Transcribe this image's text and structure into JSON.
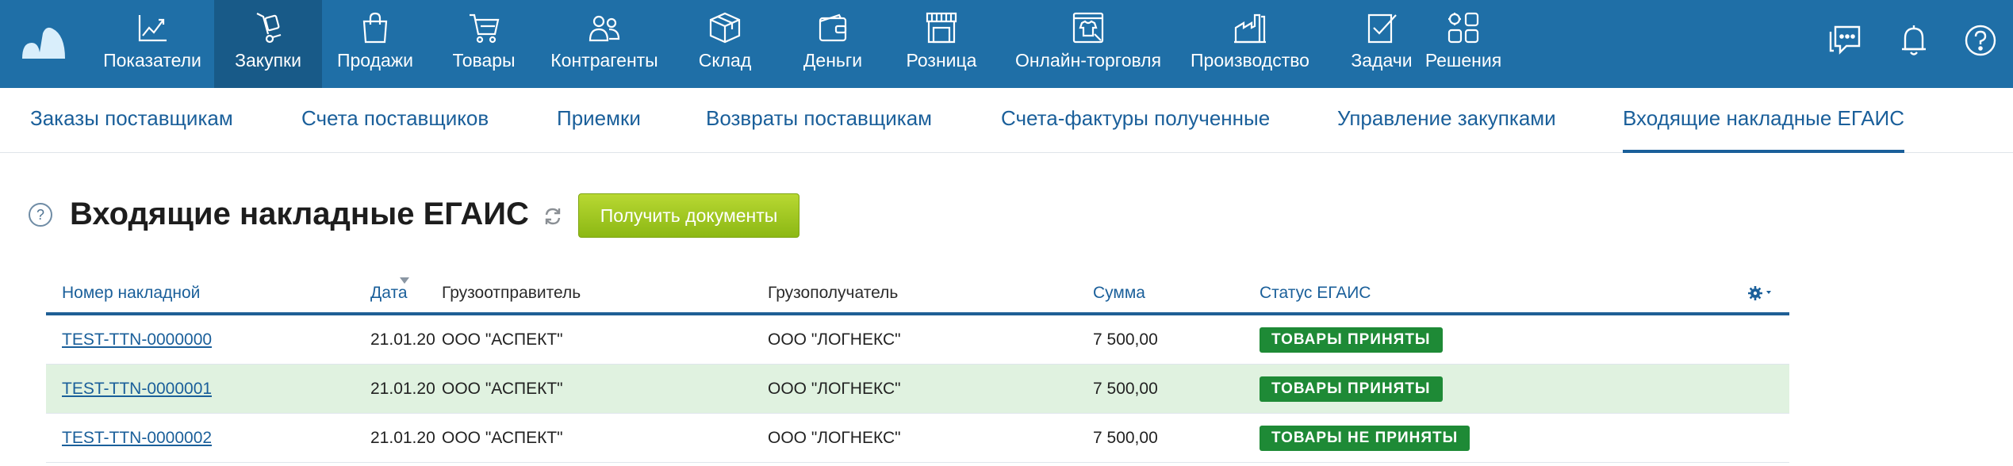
{
  "nav": {
    "items": [
      {
        "label": "Показатели",
        "icon": "chart-line-icon"
      },
      {
        "label": "Закупки",
        "icon": "hand-truck-icon",
        "active": true
      },
      {
        "label": "Продажи",
        "icon": "shopping-bag-icon"
      },
      {
        "label": "Товары",
        "icon": "cart-icon"
      },
      {
        "label": "Контрагенты",
        "icon": "people-icon"
      },
      {
        "label": "Склад",
        "icon": "box-icon"
      },
      {
        "label": "Деньги",
        "icon": "wallet-icon"
      },
      {
        "label": "Розница",
        "icon": "storefront-icon"
      },
      {
        "label": "Онлайн-торговля",
        "icon": "online-store-icon"
      },
      {
        "label": "Производство",
        "icon": "factory-icon"
      },
      {
        "label": "Задачи",
        "icon": "task-check-icon"
      },
      {
        "label": "Решения",
        "icon": "apps-grid-icon"
      }
    ],
    "right_icons": [
      "chat-icon",
      "bell-icon",
      "help-icon"
    ]
  },
  "subnav": {
    "items": [
      {
        "label": "Заказы поставщикам"
      },
      {
        "label": "Счета поставщиков"
      },
      {
        "label": "Приемки"
      },
      {
        "label": "Возвраты поставщикам"
      },
      {
        "label": "Счета-фактуры полученные"
      },
      {
        "label": "Управление закупками"
      },
      {
        "label": "Входящие накладные ЕГАИС",
        "active": true
      }
    ]
  },
  "page": {
    "help_glyph": "?",
    "title": "Входящие накладные ЕГАИС",
    "get_docs_button": "Получить документы"
  },
  "table": {
    "columns": [
      {
        "label": "Номер накладной"
      },
      {
        "label": "Дата",
        "sorted": "desc"
      },
      {
        "label": "Грузоотправитель"
      },
      {
        "label": "Грузополучатель"
      },
      {
        "label": "Сумма"
      },
      {
        "label": "Статус ЕГАИС"
      }
    ],
    "rows": [
      {
        "number": "TEST-TTN-0000000",
        "date": "21.01.20",
        "shipper": "ООО \"АСПЕКТ\"",
        "consignee": "ООО \"ЛОГНЕКС\"",
        "sum": "7 500,00",
        "status": "ТОВАРЫ ПРИНЯТЫ"
      },
      {
        "number": "TEST-TTN-0000001",
        "date": "21.01.20",
        "shipper": "ООО \"АСПЕКТ\"",
        "consignee": "ООО \"ЛОГНЕКС\"",
        "sum": "7 500,00",
        "status": "ТОВАРЫ ПРИНЯТЫ",
        "highlighted": true
      },
      {
        "number": "TEST-TTN-0000002",
        "date": "21.01.20",
        "shipper": "ООО \"АСПЕКТ\"",
        "consignee": "ООО \"ЛОГНЕКС\"",
        "sum": "7 500,00",
        "status": "ТОВАРЫ НЕ ПРИНЯТЫ"
      }
    ]
  },
  "colors": {
    "topbar": "#1f6fa7",
    "topbar_active": "#185a88",
    "link": "#1a5f9a",
    "status_green": "#1e8a36",
    "button_green": "#9ec61c",
    "row_highlight": "#e0f2e0"
  }
}
